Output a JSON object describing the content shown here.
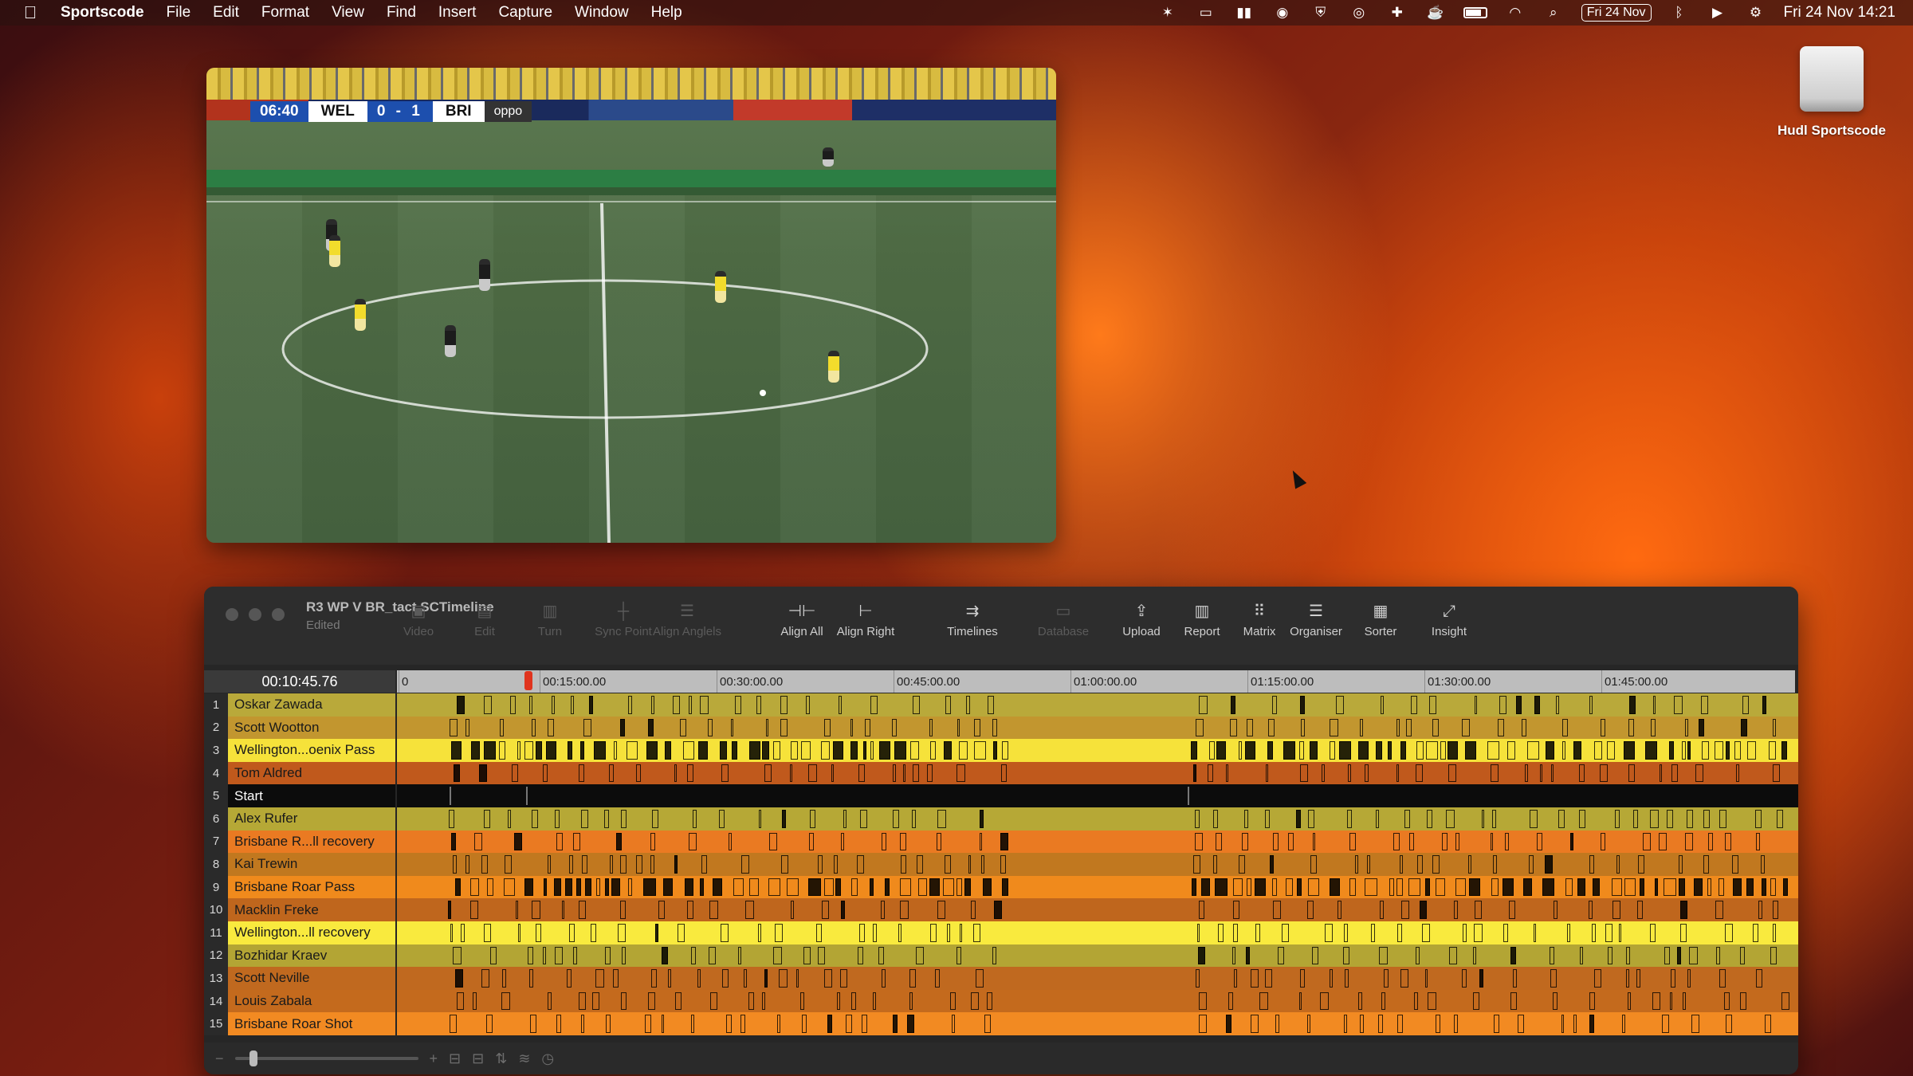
{
  "menubar": {
    "app_name": "Sportscode",
    "menus": [
      "File",
      "Edit",
      "Format",
      "View",
      "Find",
      "Insert",
      "Capture",
      "Window",
      "Help"
    ],
    "date_badge": "Fri 24 Nov",
    "clock": "Fri 24 Nov  14:21",
    "status_icons": [
      "butterfly-icon",
      "translate-icon",
      "audio-icon",
      "grammarly-icon",
      "shield-icon",
      "record-icon",
      "app-icon",
      "cat-icon",
      "battery-icon",
      "wifi-icon",
      "search-icon",
      "calendar-badge",
      "bluetooth-icon",
      "play-icon",
      "control-center-icon"
    ]
  },
  "desktop": {
    "drive_label": "Hudl Sportscode"
  },
  "video": {
    "clock": "06:40",
    "home_team": "WEL",
    "score": "0 - 1",
    "away_team": "BRI",
    "sponsor": "oppo"
  },
  "timeline": {
    "title": "R3 WP V BR_tact.SCTimeline",
    "subtitle": "Edited",
    "toolbar": [
      {
        "label": "Video",
        "icon": "video-icon",
        "enabled": false
      },
      {
        "label": "Edit",
        "icon": "edit-icon",
        "enabled": false
      },
      {
        "label": "Turn",
        "icon": "document-icon",
        "enabled": false
      },
      {
        "label": "Sync Point",
        "icon": "sync-point-icon",
        "enabled": false
      },
      {
        "label": "Align Anglels",
        "icon": "align-angles-icon",
        "enabled": false
      },
      {
        "label": "Align All",
        "icon": "align-all-icon",
        "enabled": true
      },
      {
        "label": "Align Right",
        "icon": "align-right-icon",
        "enabled": true
      },
      {
        "label": "Timelines",
        "icon": "timelines-icon",
        "enabled": true
      },
      {
        "label": "Database",
        "icon": "database-icon",
        "enabled": false
      },
      {
        "label": "Upload",
        "icon": "upload-icon",
        "enabled": true
      },
      {
        "label": "Report",
        "icon": "report-icon",
        "enabled": true
      },
      {
        "label": "Matrix",
        "icon": "matrix-icon",
        "enabled": true
      },
      {
        "label": "Organiser",
        "icon": "organiser-icon",
        "enabled": true
      },
      {
        "label": "Sorter",
        "icon": "sorter-icon",
        "enabled": true
      },
      {
        "label": "Insight",
        "icon": "insight-icon",
        "enabled": true
      }
    ],
    "current_time": "00:10:45.76",
    "ruler_labels": [
      "0",
      "00:15:00.00",
      "00:30:00.00",
      "00:45:00.00",
      "01:00:00.00",
      "01:15:00.00",
      "01:30:00.00",
      "01:45:00.00"
    ],
    "rows": [
      {
        "num": "1",
        "label": "Oskar Zawada",
        "color": "#b9a93a"
      },
      {
        "num": "2",
        "label": "Scott Wootton",
        "color": "#c2962f"
      },
      {
        "num": "3",
        "label": "Wellington...oenix Pass",
        "color": "#f6e23a"
      },
      {
        "num": "4",
        "label": "Tom Aldred",
        "color": "#c0591c"
      },
      {
        "num": "5",
        "label": "Start",
        "color": "#0c0c0c"
      },
      {
        "num": "6",
        "label": "Alex Rufer",
        "color": "#b6a836"
      },
      {
        "num": "7",
        "label": "Brisbane R...ll recovery",
        "color": "#ea7a22"
      },
      {
        "num": "8",
        "label": "Kai Trewin",
        "color": "#c1781f"
      },
      {
        "num": "9",
        "label": "Brisbane Roar Pass",
        "color": "#f08a1c"
      },
      {
        "num": "10",
        "label": "Macklin Freke",
        "color": "#bf661d"
      },
      {
        "num": "11",
        "label": "Wellington...ll recovery",
        "color": "#f9ea3e"
      },
      {
        "num": "12",
        "label": "Bozhidar Kraev",
        "color": "#b3a534"
      },
      {
        "num": "13",
        "label": "Scott Neville",
        "color": "#c0691f"
      },
      {
        "num": "14",
        "label": "Louis Zabala",
        "color": "#c46a1d"
      },
      {
        "num": "15",
        "label": "Brisbane Roar Shot",
        "color": "#f28a22"
      }
    ]
  }
}
